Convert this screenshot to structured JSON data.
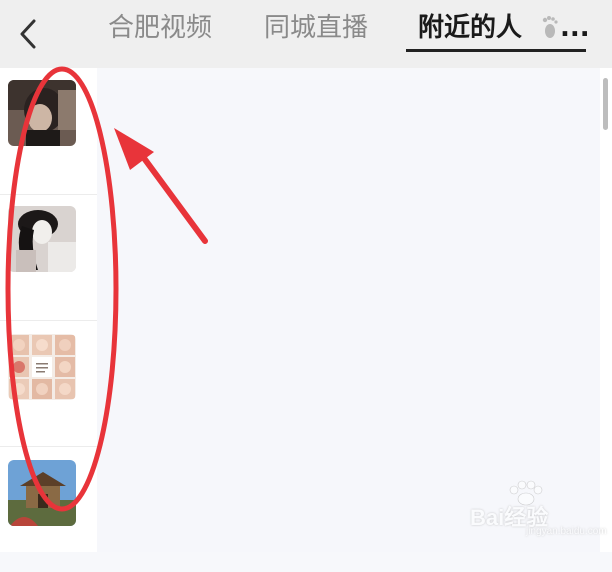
{
  "header": {
    "tabs": [
      {
        "label": "合肥视频",
        "active": false
      },
      {
        "label": "同城直播",
        "active": false
      },
      {
        "label": "附近的人",
        "active": true
      }
    ],
    "more_label": "...",
    "icons": [
      "back-arrow-icon",
      "footprint-icon"
    ]
  },
  "sidebar": {
    "items": [
      {
        "thumbnail": "person-dark-hair-photo"
      },
      {
        "thumbnail": "person-long-black-hair-photo"
      },
      {
        "thumbnail": "baby-photo-collage"
      },
      {
        "thumbnail": "building-landmark-photo"
      }
    ]
  },
  "annotation": {
    "color": "#e8343a"
  },
  "watermark": {
    "text": "Bai经验",
    "sub": "jingyan.baidu.com"
  }
}
